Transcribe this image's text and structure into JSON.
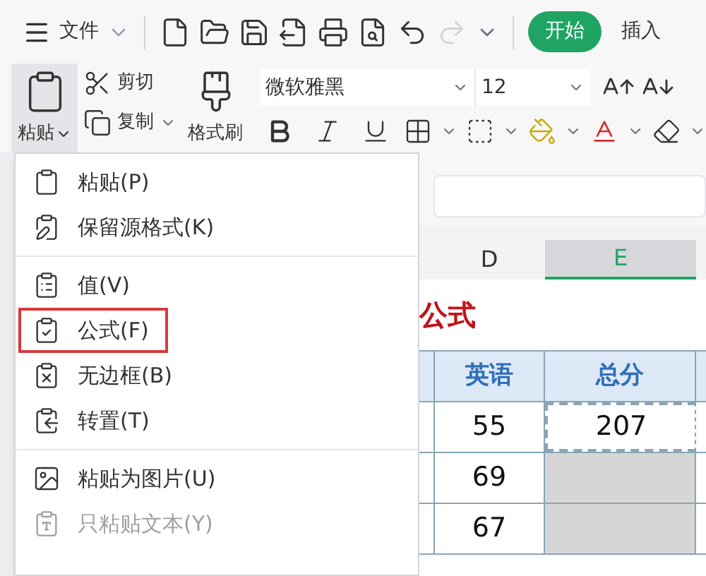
{
  "menu_bar": {
    "file_label": "文件"
  },
  "quick_access": [
    {
      "kind": "new",
      "disabled": false
    },
    {
      "kind": "open",
      "disabled": false
    },
    {
      "kind": "save",
      "disabled": false
    },
    {
      "kind": "export",
      "disabled": false
    },
    {
      "kind": "print",
      "disabled": false
    },
    {
      "kind": "preview",
      "disabled": false
    },
    {
      "kind": "undo",
      "disabled": false
    },
    {
      "kind": "redo",
      "disabled": true
    }
  ],
  "tabs": [
    {
      "label": "开始",
      "selected": true
    },
    {
      "label": "插入",
      "selected": false
    }
  ],
  "ribbon": {
    "paste": "粘贴",
    "cut": "剪切",
    "copy": "复制",
    "format_painter": "格式刷",
    "font": "微软雅黑",
    "size": "12"
  },
  "paste_menu": {
    "groups": [
      [
        {
          "label": "粘贴(P)",
          "kind": "paste",
          "disabled": false,
          "highlighted": false
        },
        {
          "label": "保留源格式(K)",
          "kind": "keep_format",
          "disabled": false,
          "highlighted": false
        }
      ],
      [
        {
          "label": "值(V)",
          "kind": "values",
          "disabled": false,
          "highlighted": false
        },
        {
          "label": "公式(F)",
          "kind": "formula",
          "disabled": false,
          "highlighted": true
        },
        {
          "label": "无边框(B)",
          "kind": "no_border",
          "disabled": false,
          "highlighted": false
        },
        {
          "label": "转置(T)",
          "kind": "transpose",
          "disabled": false,
          "highlighted": false
        }
      ],
      [
        {
          "label": "粘贴为图片(U)",
          "kind": "picture",
          "disabled": false,
          "highlighted": false
        },
        {
          "label": "只粘贴文本(Y)",
          "kind": "text",
          "disabled": true,
          "highlighted": false
        }
      ]
    ]
  },
  "sheet": {
    "columns": [
      {
        "label": "D",
        "selected": false
      },
      {
        "label": "E",
        "selected": true
      }
    ],
    "title": "公式",
    "header": [
      "英语",
      "总分"
    ],
    "rows": [
      {
        "cells": [
          "55",
          "207"
        ],
        "copied": true,
        "selected": false
      },
      {
        "cells": [
          "69",
          ""
        ],
        "copied": false,
        "selected": true
      },
      {
        "cells": [
          "67",
          ""
        ],
        "copied": false,
        "selected": true
      }
    ]
  }
}
